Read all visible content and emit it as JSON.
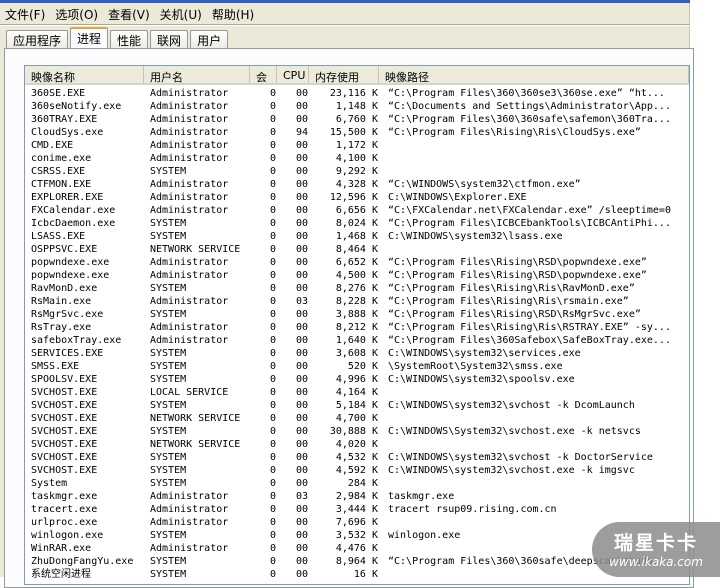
{
  "menu": [
    "文件(F)",
    "选项(O)",
    "查看(V)",
    "关机(U)",
    "帮助(H)"
  ],
  "tabs": [
    {
      "label": "应用程序",
      "active": false
    },
    {
      "label": "进程",
      "active": true
    },
    {
      "label": "性能",
      "active": false
    },
    {
      "label": "联网",
      "active": false
    },
    {
      "label": "用户",
      "active": false
    }
  ],
  "columns": [
    "映像名称",
    "用户名",
    "会",
    "CPU",
    "内存使用",
    "映像路径"
  ],
  "rows": [
    [
      "360SE.EXE",
      "Administrator",
      "0",
      "00",
      "23,116 K",
      "“C:\\Program Files\\360\\360se3\\360se.exe”  “ht..."
    ],
    [
      "360seNotify.exe",
      "Administrator",
      "0",
      "00",
      "1,148 K",
      "“C:\\Documents and Settings\\Administrator\\App..."
    ],
    [
      "360TRAY.EXE",
      "Administrator",
      "0",
      "00",
      "6,760 K",
      "“C:\\Program Files\\360\\360safe\\safemon\\360Tra..."
    ],
    [
      "CloudSys.exe",
      "Administrator",
      "0",
      "94",
      "15,500 K",
      "“C:\\Program Files\\Rising\\Ris\\CloudSys.exe”"
    ],
    [
      "CMD.EXE",
      "Administrator",
      "0",
      "00",
      "1,172 K",
      ""
    ],
    [
      "conime.exe",
      "Administrator",
      "0",
      "00",
      "4,100 K",
      ""
    ],
    [
      "CSRSS.EXE",
      "SYSTEM",
      "0",
      "00",
      "9,292 K",
      ""
    ],
    [
      "CTFMON.EXE",
      "Administrator",
      "0",
      "00",
      "4,328 K",
      "“C:\\WINDOWS\\system32\\ctfmon.exe”"
    ],
    [
      "EXPLORER.EXE",
      "Administrator",
      "0",
      "00",
      "12,596 K",
      "C:\\WINDOWS\\Explorer.EXE"
    ],
    [
      "FXCalendar.exe",
      "Administrator",
      "0",
      "00",
      "6,656 K",
      "“C:\\FXCalendar.net\\FXCalendar.exe” /sleeptime=0"
    ],
    [
      "IcbcDaemon.exe",
      "SYSTEM",
      "0",
      "00",
      "8,024 K",
      "“C:\\Program Files\\ICBCEbankTools\\ICBCAntiPhi..."
    ],
    [
      "LSASS.EXE",
      "SYSTEM",
      "0",
      "00",
      "1,468 K",
      "C:\\WINDOWS\\system32\\lsass.exe"
    ],
    [
      "OSPPSVC.EXE",
      "NETWORK SERVICE",
      "0",
      "00",
      "8,464 K",
      ""
    ],
    [
      "popwndexe.exe",
      "Administrator",
      "0",
      "00",
      "6,652 K",
      "“C:\\Program Files\\Rising\\RSD\\popwndexe.exe”"
    ],
    [
      "popwndexe.exe",
      "Administrator",
      "0",
      "00",
      "4,500 K",
      "“C:\\Program Files\\Rising\\RSD\\popwndexe.exe”"
    ],
    [
      "RavMonD.exe",
      "SYSTEM",
      "0",
      "00",
      "8,276 K",
      "“C:\\Program Files\\Rising\\Ris\\RavMonD.exe”"
    ],
    [
      "RsMain.exe",
      "Administrator",
      "0",
      "03",
      "8,228 K",
      "“C:\\Program Files\\Rising\\Ris\\rsmain.exe”"
    ],
    [
      "RsMgrSvc.exe",
      "SYSTEM",
      "0",
      "00",
      "3,888 K",
      "“C:\\Program Files\\Rising\\RSD\\RsMgrSvc.exe”"
    ],
    [
      "RsTray.exe",
      "Administrator",
      "0",
      "00",
      "8,212 K",
      "“C:\\Program Files\\Rising\\Ris\\RSTRAY.EXE” -sy..."
    ],
    [
      "safeboxTray.exe",
      "Administrator",
      "0",
      "00",
      "1,640 K",
      "“C:\\Program Files\\360Safebox\\SafeBoxTray.exe..."
    ],
    [
      "SERVICES.EXE",
      "SYSTEM",
      "0",
      "00",
      "3,608 K",
      "C:\\WINDOWS\\system32\\services.exe"
    ],
    [
      "SMSS.EXE",
      "SYSTEM",
      "0",
      "00",
      "520 K",
      "\\SystemRoot\\System32\\smss.exe"
    ],
    [
      "SPOOLSV.EXE",
      "SYSTEM",
      "0",
      "00",
      "4,996 K",
      "C:\\WINDOWS\\system32\\spoolsv.exe"
    ],
    [
      "SVCHOST.EXE",
      "LOCAL SERVICE",
      "0",
      "00",
      "4,164 K",
      ""
    ],
    [
      "SVCHOST.EXE",
      "SYSTEM",
      "0",
      "00",
      "5,184 K",
      "C:\\WINDOWS\\system32\\svchost -k DcomLaunch"
    ],
    [
      "SVCHOST.EXE",
      "NETWORK SERVICE",
      "0",
      "00",
      "4,700 K",
      ""
    ],
    [
      "SVCHOST.EXE",
      "SYSTEM",
      "0",
      "00",
      "30,888 K",
      "C:\\WINDOWS\\System32\\svchost.exe -k netsvcs"
    ],
    [
      "SVCHOST.EXE",
      "NETWORK SERVICE",
      "0",
      "00",
      "4,020 K",
      ""
    ],
    [
      "SVCHOST.EXE",
      "SYSTEM",
      "0",
      "00",
      "4,532 K",
      "C:\\WINDOWS\\system32\\svchost -k DoctorService"
    ],
    [
      "SVCHOST.EXE",
      "SYSTEM",
      "0",
      "00",
      "4,592 K",
      "C:\\WINDOWS\\system32\\svchost.exe -k imgsvc"
    ],
    [
      "System",
      "SYSTEM",
      "0",
      "00",
      "284 K",
      ""
    ],
    [
      "taskmgr.exe",
      "Administrator",
      "0",
      "03",
      "2,984 K",
      "taskmgr.exe"
    ],
    [
      "tracert.exe",
      "Administrator",
      "0",
      "00",
      "3,444 K",
      "tracert rsup09.rising.com.cn"
    ],
    [
      "urlproc.exe",
      "Administrator",
      "0",
      "00",
      "7,696 K",
      ""
    ],
    [
      "winlogon.exe",
      "SYSTEM",
      "0",
      "00",
      "3,532 K",
      "winlogon.exe"
    ],
    [
      "WinRAR.exe",
      "Administrator",
      "0",
      "00",
      "4,476 K",
      ""
    ],
    [
      "ZhuDongFangYu.exe",
      "SYSTEM",
      "0",
      "00",
      "8,964 K",
      "“C:\\Program Files\\360\\360safe\\deepscan\\zhudo..."
    ],
    [
      "系统空闲进程",
      "SYSTEM",
      "0",
      "00",
      "16 K",
      ""
    ]
  ],
  "watermark": {
    "title": "瑞星卡卡",
    "url": "www.ikaka.com"
  }
}
